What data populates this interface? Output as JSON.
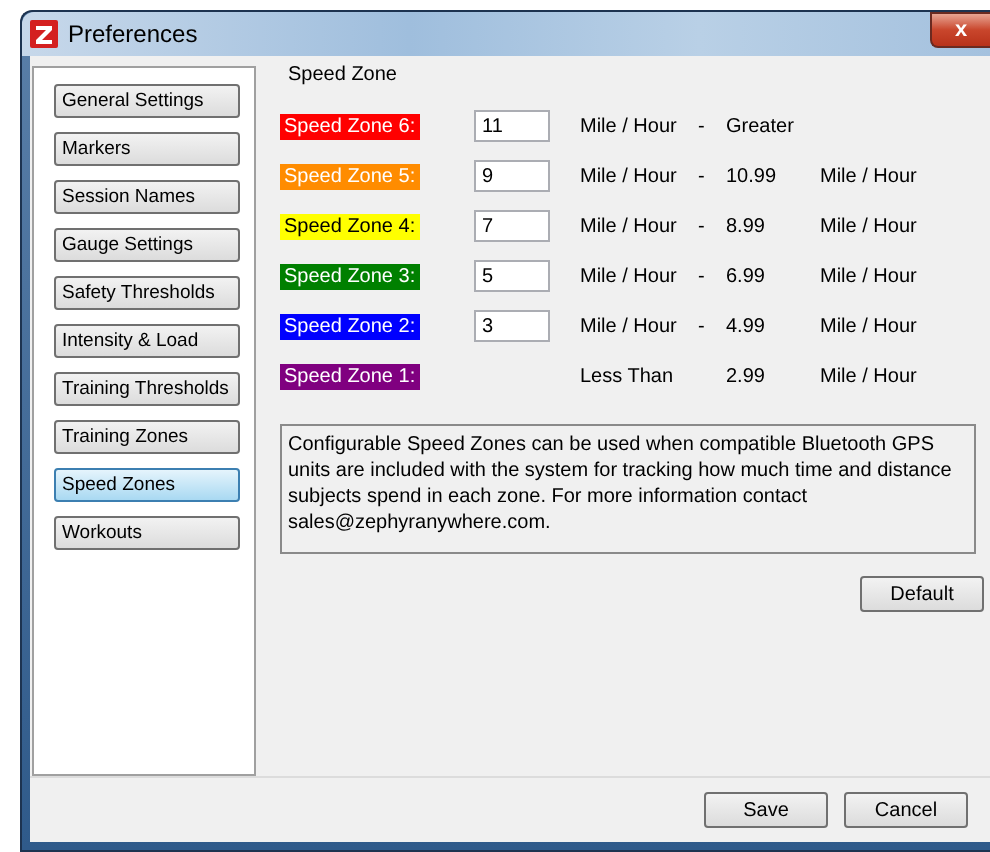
{
  "window": {
    "title": "Preferences",
    "close": "x"
  },
  "sidebar": {
    "items": [
      {
        "label": "General Settings",
        "selected": false
      },
      {
        "label": "Markers",
        "selected": false
      },
      {
        "label": "Session Names",
        "selected": false
      },
      {
        "label": "Gauge Settings",
        "selected": false
      },
      {
        "label": "Safety Thresholds",
        "selected": false
      },
      {
        "label": "Intensity & Load",
        "selected": false
      },
      {
        "label": "Training Thresholds",
        "selected": false
      },
      {
        "label": "Training Zones",
        "selected": false
      },
      {
        "label": "Speed Zones",
        "selected": true
      },
      {
        "label": "Workouts",
        "selected": false
      }
    ]
  },
  "group": {
    "title": "Speed Zone",
    "zones": [
      {
        "label": "Speed Zone 6:",
        "color": "#ff0000",
        "value": "11",
        "unit": "Mile / Hour",
        "separator": "-",
        "limit": "Greater"
      },
      {
        "label": "Speed Zone 5:",
        "color": "#ff8c00",
        "value": "9",
        "unit": "Mile / Hour",
        "separator": "-",
        "limit": "10.99",
        "limit_unit": "Mile / Hour"
      },
      {
        "label": "Speed Zone 4:",
        "color": "#ffff00",
        "value": "7",
        "unit": "Mile / Hour",
        "separator": "-",
        "limit": "8.99",
        "limit_unit": "Mile / Hour"
      },
      {
        "label": "Speed Zone 3:",
        "color": "#008000",
        "value": "5",
        "unit": "Mile / Hour",
        "separator": "-",
        "limit": "6.99",
        "limit_unit": "Mile / Hour"
      },
      {
        "label": "Speed Zone 2:",
        "color": "#0000ff",
        "value": "3",
        "unit": "Mile / Hour",
        "separator": "-",
        "limit": "4.99",
        "limit_unit": "Mile / Hour"
      },
      {
        "label": "Speed Zone 1:",
        "color": "#800080",
        "unit": "Less Than",
        "limit": "2.99",
        "limit_unit": "Mile / Hour"
      }
    ],
    "description": "Configurable Speed Zones can be used when compatible Bluetooth GPS units are included with the system for tracking how much time and distance subjects spend in each zone.  For more information contact sales@zephyranywhere.com.",
    "default_button": "Default"
  },
  "buttons": [
    "Save",
    "Cancel"
  ]
}
